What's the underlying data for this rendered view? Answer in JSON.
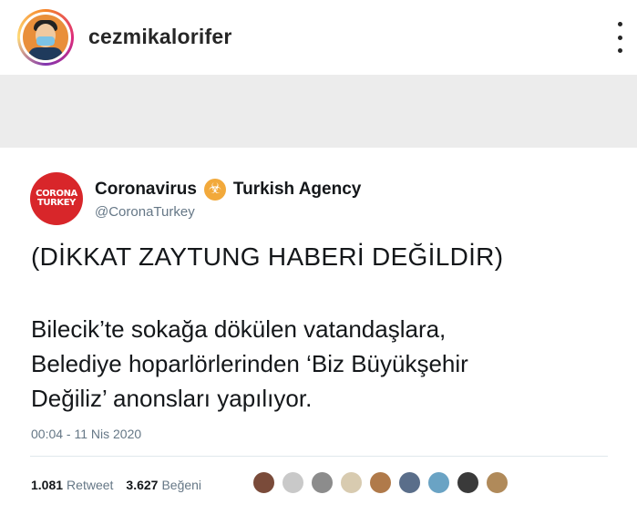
{
  "instagram": {
    "username": "cezmikalorifer",
    "avatar_icon": "profile-avatar",
    "more_icon": "more-vertical-icon"
  },
  "tweet": {
    "avatar": {
      "line1": "CORONA",
      "line2": "TURKEY"
    },
    "name_part1": "Coronavirus",
    "name_emoji": "☣",
    "name_part2": "Turkish Agency",
    "handle": "@CoronaTurkey",
    "warning": "(DİKKAT ZAYTUNG HABERİ DEĞİLDİR)",
    "body_lines": [
      "Bilecik’te sokağa dökülen vatandaşlara,",
      "Belediye hoparlörlerinden ‘Biz Büyükşehir",
      "Değiliz’ anonsları yapılıyor."
    ],
    "timestamp": "00:04 - 11 Nis 2020",
    "retweet_count": "1.081",
    "retweet_label": "Retweet",
    "like_count": "3.627",
    "like_label": "Beğeni",
    "liker_colors": [
      "#7a4b3a",
      "#c9c9c9",
      "#8c8c8c",
      "#d8cbb0",
      "#b07a4a",
      "#5a6e8a",
      "#6aa3c4",
      "#3a3a3a",
      "#b08a5a"
    ]
  },
  "colors": {
    "ig_text": "#262626",
    "grey_band": "#ececec",
    "twitter_text": "#14171a",
    "twitter_secondary": "#657786",
    "avatar_red": "#d8262a",
    "biohazard": "#f2a93b"
  }
}
